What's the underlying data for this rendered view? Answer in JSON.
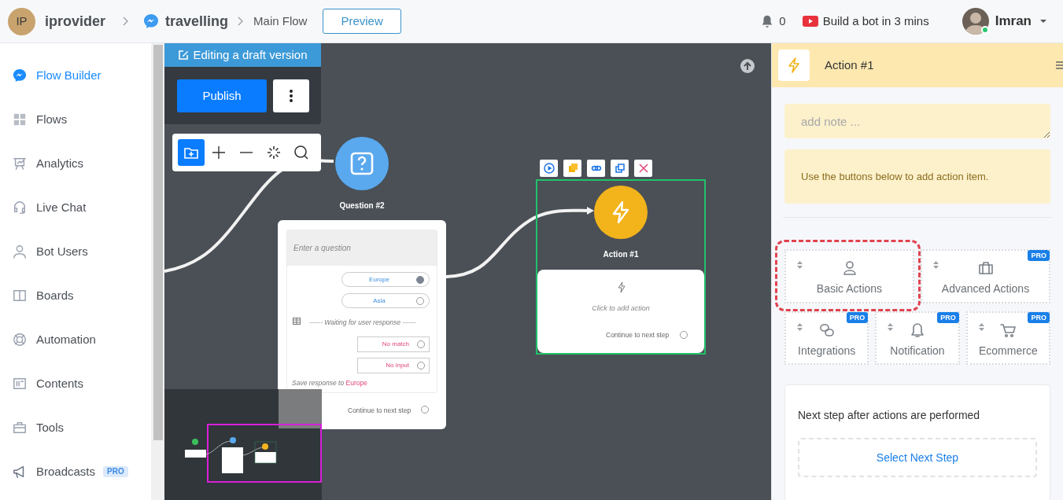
{
  "header": {
    "workspace": {
      "initials": "IP",
      "name": "iprovider"
    },
    "bot": "travelling",
    "flow": "Main Flow",
    "preview_button": "Preview",
    "notifications": "0",
    "promo": "Build a bot in 3 mins",
    "user": "Imran"
  },
  "sidebar": {
    "items": [
      {
        "label": "Flow Builder",
        "selected": true,
        "kind": "messenger"
      },
      {
        "label": "Flows",
        "selected": false,
        "kind": "grid"
      },
      {
        "label": "Analytics",
        "selected": false,
        "kind": "chart"
      },
      {
        "label": "Live Chat",
        "selected": false,
        "kind": "headset"
      },
      {
        "label": "Bot Users",
        "selected": false,
        "kind": "user"
      },
      {
        "label": "Boards",
        "selected": false,
        "kind": "columns"
      },
      {
        "label": "Automation",
        "selected": false,
        "kind": "lifebuoy"
      },
      {
        "label": "Contents",
        "selected": false,
        "kind": "contents"
      },
      {
        "label": "Tools",
        "selected": false,
        "kind": "tools"
      },
      {
        "label": "Broadcasts",
        "selected": false,
        "kind": "megaphone",
        "badge": "PRO"
      }
    ]
  },
  "canvas": {
    "draft_banner": "Editing a draft version",
    "publish_button": "Publish",
    "tools": [
      {
        "kind": "add-folder",
        "selected": true
      },
      {
        "kind": "zoom-in",
        "selected": false
      },
      {
        "kind": "zoom-out",
        "selected": false
      },
      {
        "kind": "fit",
        "selected": false
      },
      {
        "kind": "search",
        "selected": false
      }
    ],
    "question_node": {
      "title": "Question #2",
      "prompt_placeholder": "Enter a question",
      "options": [
        {
          "label": "Europe",
          "selected": true
        },
        {
          "label": "Asia",
          "selected": false
        }
      ],
      "waiting": "------ Waiting for user response ------",
      "fallbacks": [
        {
          "label": "No match",
          "selected": false
        },
        {
          "label": "No input",
          "selected": false
        }
      ],
      "save_label": "Save response to",
      "save_variable": "Europe",
      "continue": "Continue to next step",
      "continue_selected": false
    },
    "action_node": {
      "title": "Action #1",
      "hint": "Click to add action",
      "continue": "Continue to next step",
      "continue_selected": false,
      "selected": true
    }
  },
  "panel": {
    "title": "Action #1",
    "note_placeholder": "add note ...",
    "info": "Use the buttons below to add action item.",
    "actions": [
      {
        "label": "Basic Actions",
        "kind": "basic",
        "highlighted": true
      },
      {
        "label": "Advanced Actions",
        "kind": "advanced",
        "badge": "PRO",
        "highlighted": false
      },
      {
        "label": "Integrations",
        "kind": "integrations",
        "badge": "PRO",
        "highlighted": false
      },
      {
        "label": "Notification",
        "kind": "notification",
        "badge": "PRO",
        "highlighted": false
      },
      {
        "label": "Ecommerce",
        "kind": "ecommerce",
        "badge": "PRO",
        "highlighted": false
      }
    ],
    "next_step_label": "Next step after actions are performed",
    "next_step_button": "Select Next Step"
  }
}
